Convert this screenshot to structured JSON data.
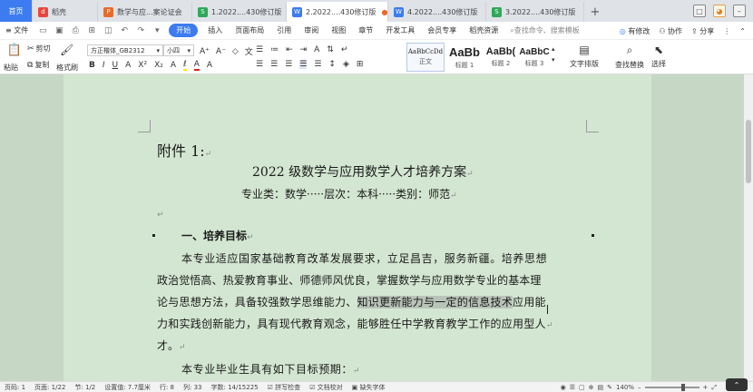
{
  "tabs": [
    {
      "label": "首页",
      "type": "home"
    },
    {
      "label": "稻壳",
      "icon_color": "#e8453c",
      "icon": "d"
    },
    {
      "label": "数学与应...案论证会",
      "icon_color": "#e86b2c",
      "icon": "P"
    },
    {
      "label": "1.2022....430修订版",
      "icon_color": "#2fa85a",
      "icon": "S"
    },
    {
      "label": "2.2022....430修订版",
      "icon_color": "#3c7cf0",
      "icon": "W",
      "active": true
    },
    {
      "label": "4.2022....430修订版",
      "icon_color": "#3c7cf0",
      "icon": "W"
    },
    {
      "label": "3.2022....430修订版",
      "icon_color": "#2fa85a",
      "icon": "S"
    }
  ],
  "tab_add": "+",
  "menu": {
    "file": "文件",
    "items": [
      "开始",
      "插入",
      "页面布局",
      "引用",
      "审阅",
      "视图",
      "章节",
      "开发工具",
      "会员专享",
      "稻壳资源"
    ],
    "active_index": 0,
    "search": "查找命令、搜索模板",
    "right": [
      "有修改",
      "协作",
      "分享"
    ]
  },
  "ribbon": {
    "cut": "剪切",
    "paste": "粘贴",
    "copy": "复制",
    "format_painter": "格式刷",
    "font_name": "方正楷体_GB2312",
    "font_size": "小四",
    "styles": [
      {
        "preview": "AaBbCcDd",
        "label": "正文"
      },
      {
        "preview": "AaBb",
        "label": "标题 1"
      },
      {
        "preview": "AaBb(",
        "label": "标题 2"
      },
      {
        "preview": "AaBbC",
        "label": "标题 3"
      }
    ],
    "text_layout": "文字排版",
    "find_replace": "查找替换",
    "select": "选择"
  },
  "document": {
    "attachment": "附件 1:",
    "title": "2022 级数学与应用数学人才培养方案",
    "subtitle": "专业类：数学·····层次：本科·····类别：师范",
    "section1": "一、培养目标",
    "para1_l1": "本专业适应国家基础教育改革发展要求，立足昌吉，服务新疆。培养思想",
    "para1_l2": "政治觉悟高、热爱教育事业、师德师风优良，掌握数学与应用数学专业的基本理",
    "para1_l3a": "论与思想方法，具备较强数学思维能力、",
    "para1_l3b": "知识更新能力与一定的信息技术",
    "para1_l3c": "应用能",
    "para1_l4": "力和实践创新能力，具有现代教育观念，能够胜任中学教育教学工作的应用型人",
    "para1_l5": "才。",
    "para2": "本专业毕业生具有如下目标预期：",
    "return_mark": "↵"
  },
  "status": {
    "page": "页码: 1",
    "pages": "页面: 1/22",
    "section": "节: 1/2",
    "setting": "设置值: 7.7厘米",
    "row": "行: 8",
    "col": "列: 33",
    "words": "字数: 14/15225",
    "spell": "拼写检查",
    "proof": "文档校对",
    "missing_font": "缺失字体",
    "zoom": "140%"
  }
}
